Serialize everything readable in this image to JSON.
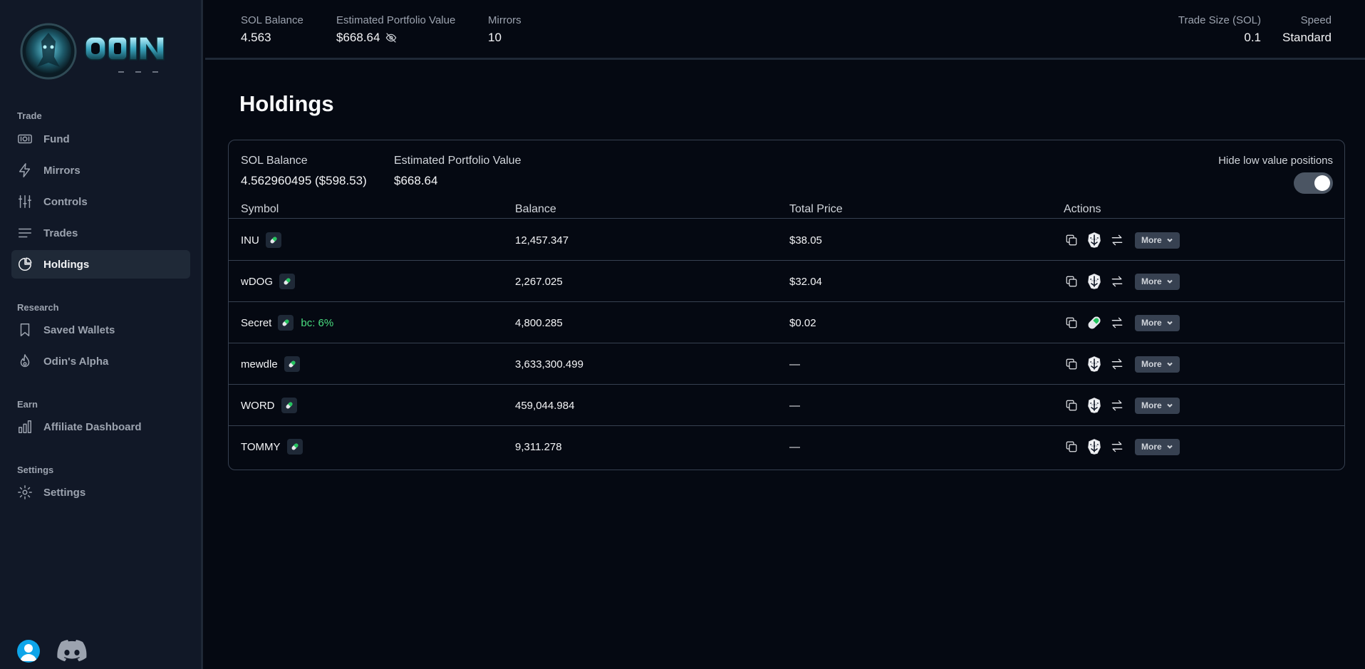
{
  "topbar": {
    "sol_balance_label": "SOL Balance",
    "sol_balance_value": "4.563",
    "portfolio_label": "Estimated Portfolio Value",
    "portfolio_value": "$668.64",
    "mirrors_label": "Mirrors",
    "mirrors_value": "10",
    "trade_size_label": "Trade Size (SOL)",
    "trade_size_value": "0.1",
    "speed_label": "Speed",
    "speed_value": "Standard"
  },
  "sidebar": {
    "sections": [
      {
        "title": "Trade"
      },
      {
        "title": "Research"
      },
      {
        "title": "Earn"
      },
      {
        "title": "Settings"
      }
    ],
    "items": [
      {
        "label": "Fund",
        "icon": "money-icon"
      },
      {
        "label": "Mirrors",
        "icon": "lightning-icon"
      },
      {
        "label": "Controls",
        "icon": "sliders-icon"
      },
      {
        "label": "Trades",
        "icon": "list-icon"
      },
      {
        "label": "Holdings",
        "icon": "pie-chart-icon",
        "active": true
      },
      {
        "label": "Saved Wallets",
        "icon": "bookmark-icon"
      },
      {
        "label": "Odin's Alpha",
        "icon": "fire-icon"
      },
      {
        "label": "Affiliate Dashboard",
        "icon": "bar-chart-icon"
      },
      {
        "label": "Settings",
        "icon": "gear-icon"
      }
    ]
  },
  "main": {
    "title": "Holdings",
    "sol_balance_label": "SOL Balance",
    "sol_balance_value": "4.562960495 ($598.53)",
    "portfolio_label": "Estimated Portfolio Value",
    "portfolio_value": "$668.64",
    "hide_low_label": "Hide low value positions",
    "hide_low_enabled": true,
    "columns": [
      "Symbol",
      "Balance",
      "Total Price",
      "Actions"
    ],
    "more_label": "More",
    "rows": [
      {
        "symbol": "INU",
        "balance": "12,457.347",
        "total_price": "$38.05",
        "bc": ""
      },
      {
        "symbol": "wDOG",
        "balance": "2,267.025",
        "total_price": "$32.04",
        "bc": ""
      },
      {
        "symbol": "Secret",
        "balance": "4,800.285",
        "total_price": "$0.02",
        "bc": "bc: 6%"
      },
      {
        "symbol": "mewdle",
        "balance": "3,633,300.499",
        "total_price": "—",
        "bc": ""
      },
      {
        "symbol": "WORD",
        "balance": "459,044.984",
        "total_price": "—",
        "bc": ""
      },
      {
        "symbol": "TOMMY",
        "balance": "9,311.278",
        "total_price": "—",
        "bc": ""
      }
    ]
  },
  "colors": {
    "background": "#050912",
    "sidebar": "#111827",
    "border": "#374151",
    "accent_green": "#4ade80",
    "avatar": "#0ea5e9"
  }
}
